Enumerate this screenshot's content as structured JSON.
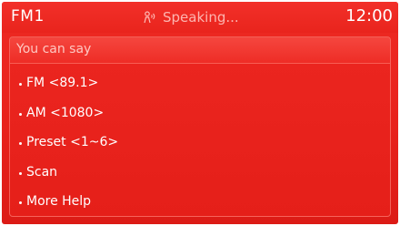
{
  "status_bar": {
    "band": "FM1",
    "voice_status": "Speaking...",
    "voice_icon": "voice-speaking-icon",
    "clock": "12:00"
  },
  "panel": {
    "title": "You can say",
    "commands": [
      {
        "label": "FM <89.1>"
      },
      {
        "label": "AM <1080>"
      },
      {
        "label": "Preset <1~6>"
      },
      {
        "label": "Scan"
      },
      {
        "label": "More Help"
      }
    ]
  },
  "colors": {
    "background": "#e8221c",
    "text": "#ffffff",
    "muted_text": "#ffcdc8"
  }
}
